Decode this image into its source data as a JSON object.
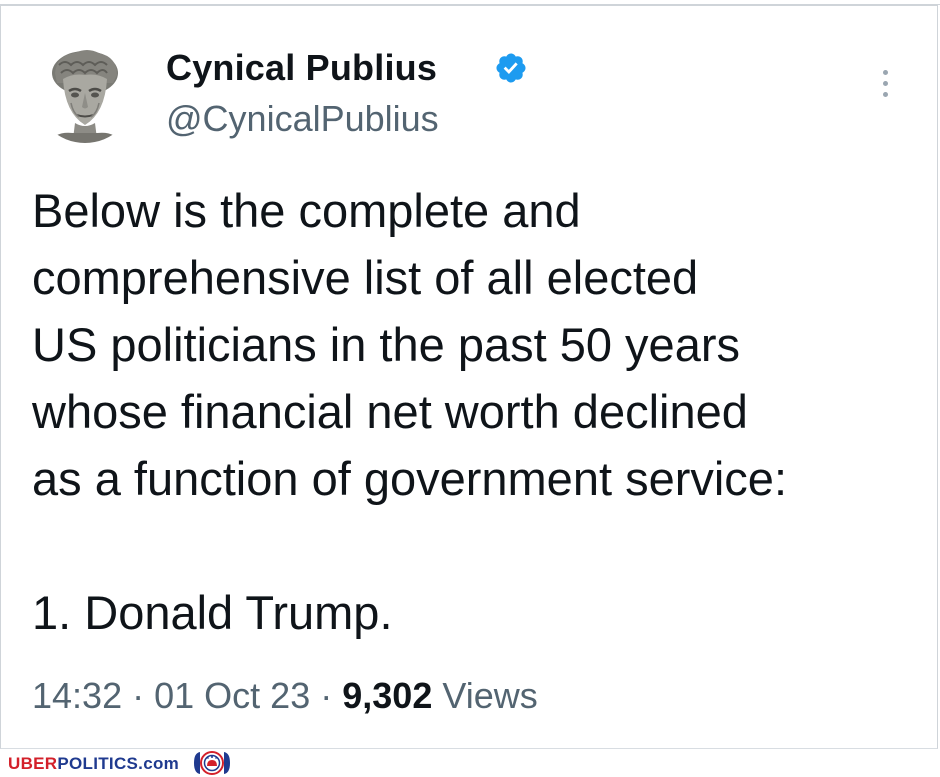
{
  "tweet": {
    "author": {
      "display_name": "Cynical Publius",
      "handle": "@CynicalPublius",
      "verified": true,
      "avatar_icon": "marble-bust-avatar"
    },
    "menu_icon": "more-vertical-icon",
    "text_lines": [
      "Below is the complete and",
      "comprehensive list of all elected",
      "US politicians in the past 50 years",
      "whose financial net worth declined",
      "as a function of government service:",
      "",
      "1. Donald Trump."
    ],
    "time": "14:32",
    "separator": "·",
    "date": "01 Oct 23",
    "views_count": "9,302",
    "views_label": "Views"
  },
  "watermark": {
    "brand_part1": "UBER",
    "brand_part2": "POLITICS",
    "brand_part3": ".com",
    "logo_icon": "elephant-donkey-seal-icon"
  },
  "colors": {
    "text_primary": "#0f1419",
    "text_secondary": "#536471",
    "verified_blue": "#1d9bf0",
    "watermark_red": "#d3202a",
    "watermark_blue": "#1f3a8f"
  }
}
